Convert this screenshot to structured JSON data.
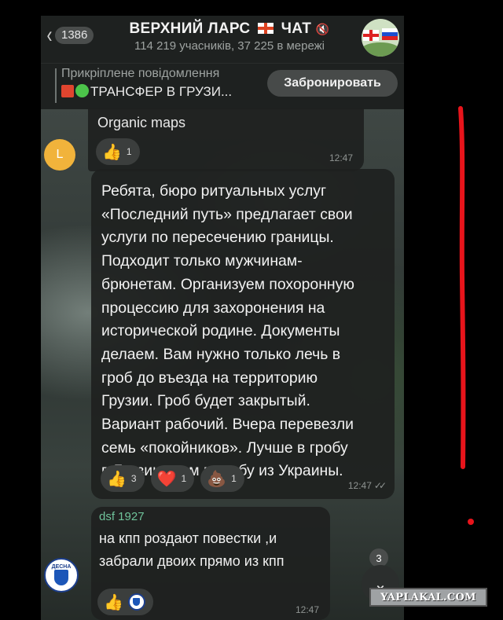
{
  "header": {
    "back_count": "1386",
    "title_left": "ВЕРХНИЙ ЛАРС",
    "title_right": "ЧАТ",
    "subtitle": "114 219 учасників, 37 225 в мережі"
  },
  "pinned": {
    "title": "Прикріплене повідомлення",
    "text": "ТРАНСФЕР В ГРУЗИ...",
    "button_label": "Забронировать"
  },
  "messages": [
    {
      "text": "Organic maps",
      "avatar_letter": "L",
      "reactions": [
        {
          "emoji": "👍",
          "count": "1"
        }
      ],
      "time": "12:47"
    },
    {
      "text": "Ребята, бюро ритуальных услуг\n«Последний путь» предлагает свои\nуслуги по пересечению границы.\nПодходит только мужчинам-\nбрюнетам. Организуем похоронную\nпроцессию для захоронения на\nисторической родине. Документы\nделаем. Вам нужно только лечь в\nгроб до въезда на территорию\nГрузии. Гроб будет закрытый.\nВариант рабочий. Вчера перевезли\nсемь «покойников». Лучше в гробу\nв Грузию, чем в гробу из Украины.",
      "reactions": [
        {
          "emoji": "👍",
          "count": "3"
        },
        {
          "emoji": "❤️",
          "count": "1"
        },
        {
          "emoji": "💩",
          "count": "1"
        }
      ],
      "time": "12:47"
    },
    {
      "sender": "dsf 1927",
      "text": "на кпп роздают повестки ,и\nзабрали двоих прямо из кпп",
      "reactions": [
        {
          "emoji": "👍"
        }
      ],
      "time": "12:47"
    }
  ],
  "scroll": {
    "unread_badge": "3"
  },
  "avatar_desna_label": "ДЕСНА",
  "watermark": "YAPLAKAL.COM",
  "colors": {
    "annotation": "#e8141b",
    "sender_name": "#6fc39a"
  }
}
